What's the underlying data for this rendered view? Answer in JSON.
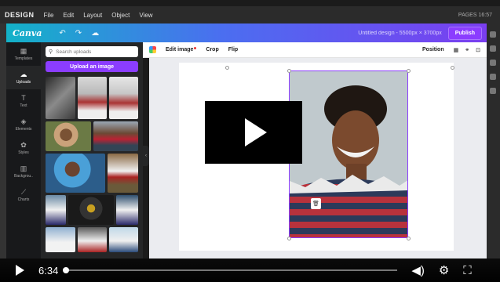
{
  "app": {
    "name": "DESIGN",
    "menu": [
      "File",
      "Edit",
      "Layout",
      "Object",
      "View"
    ],
    "status": "PAGES 16:57"
  },
  "header": {
    "logo": "Canva",
    "doc_title": "Untitled design - 5500px × 3700px",
    "publish_label": "Publish"
  },
  "rail": {
    "items": [
      {
        "label": "Templates",
        "icon": "templates-icon",
        "glyph": "▦"
      },
      {
        "label": "Uploads",
        "icon": "upload-icon",
        "glyph": "☁"
      },
      {
        "label": "Text",
        "icon": "text-icon",
        "glyph": "T"
      },
      {
        "label": "Elements",
        "icon": "elements-icon",
        "glyph": "◈"
      },
      {
        "label": "Styles",
        "icon": "styles-icon",
        "glyph": "✿"
      },
      {
        "label": "Backgrou..",
        "icon": "background-icon",
        "glyph": "▥"
      },
      {
        "label": "Charts",
        "icon": "charts-icon",
        "glyph": "⟋"
      }
    ],
    "active_index": 1
  },
  "uploads": {
    "search_placeholder": "Search uploads",
    "upload_button": "Upload an image"
  },
  "toolbar": {
    "edit_image": "Edit image",
    "crop": "Crop",
    "flip": "Flip",
    "position": "Position"
  },
  "video": {
    "current_time": "6:34",
    "progress": 0.0
  },
  "colors": {
    "accent": "#8b3dff",
    "header_start": "#13b2c8",
    "header_end": "#7a3ef0"
  }
}
